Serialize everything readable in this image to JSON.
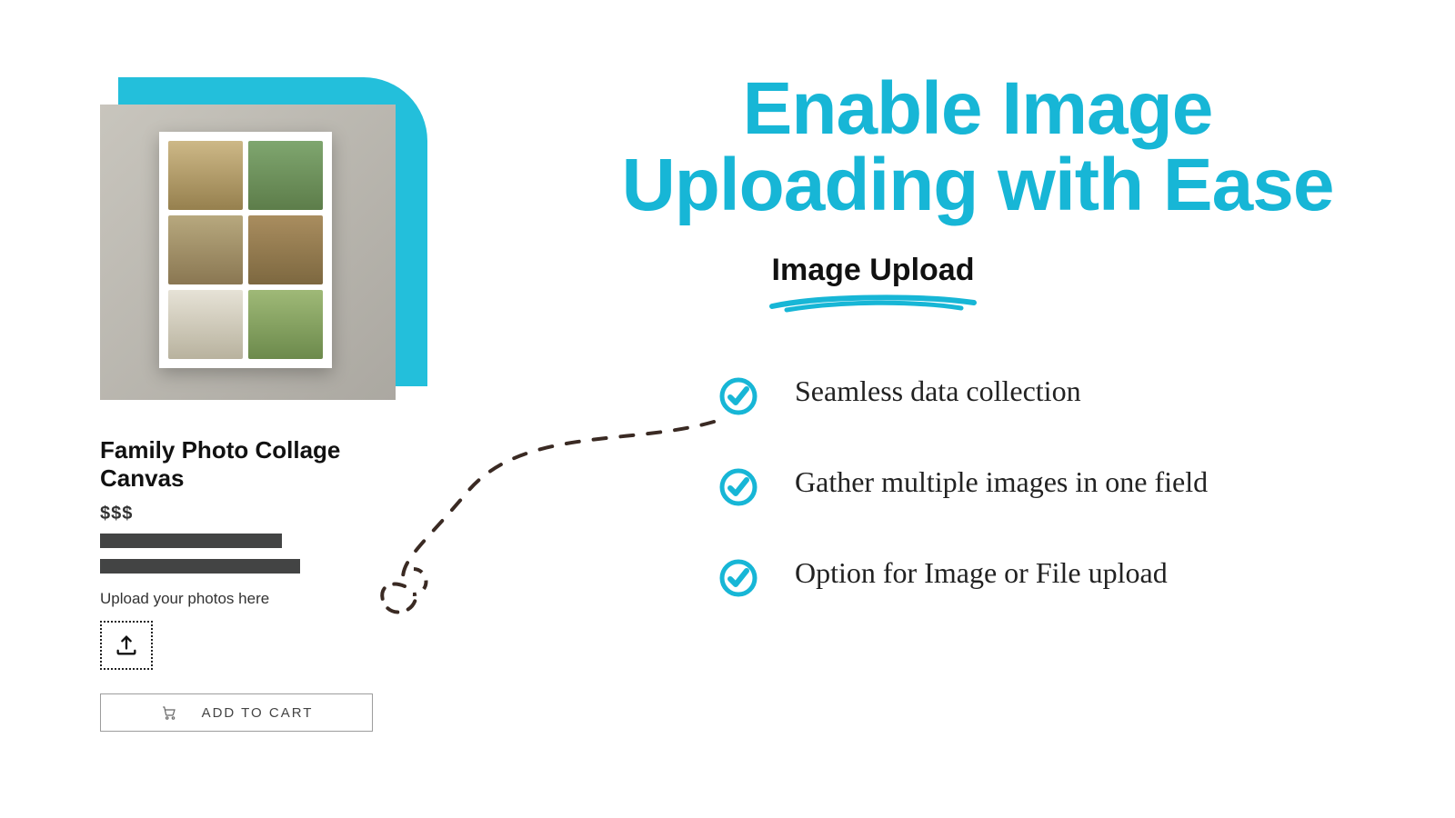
{
  "colors": {
    "accent": "#17b6d6",
    "accentFill": "#23bfdb"
  },
  "headline": {
    "line1": "Enable Image",
    "line2": "Uploading with Ease"
  },
  "subheading": "Image Upload",
  "features": [
    "Seamless data collection",
    "Gather multiple images in one field",
    "Option for Image or File upload"
  ],
  "product": {
    "title": "Family Photo Collage Canvas",
    "price": "$$$",
    "upload_label": "Upload your photos here",
    "cart_label": "ADD TO CART"
  },
  "icons": {
    "upload": "upload-icon",
    "cart": "cart-icon",
    "check": "check-circle-icon"
  }
}
